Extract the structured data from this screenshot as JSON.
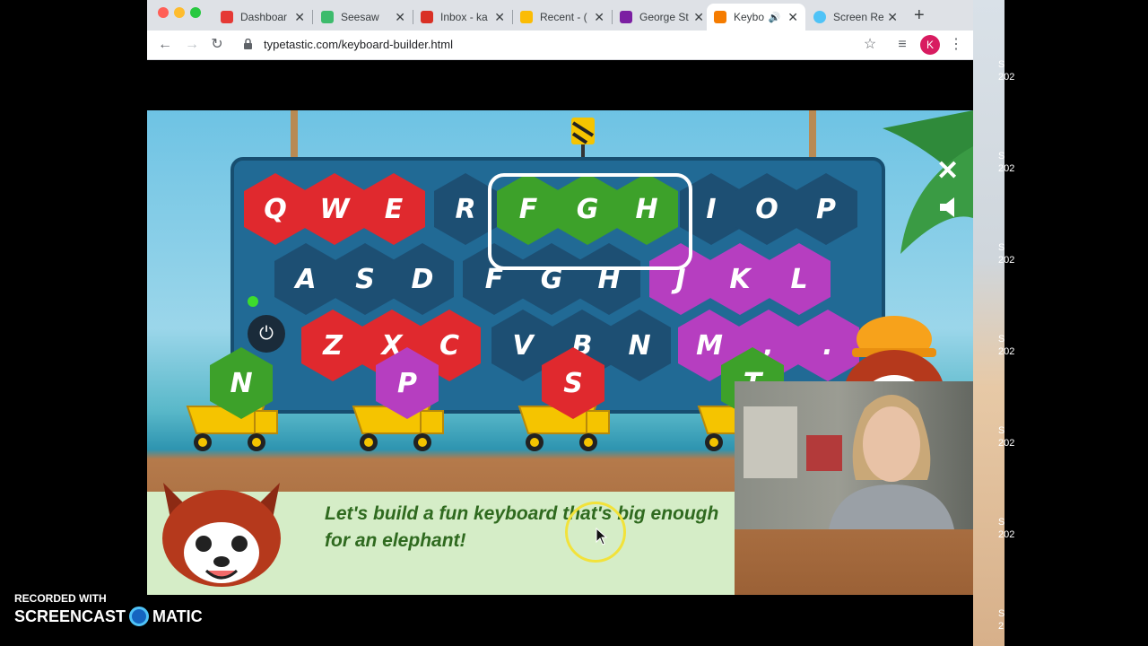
{
  "browser": {
    "tabs": [
      {
        "title": "Dashboar",
        "favicon_color": "#e53935"
      },
      {
        "title": "Seesaw",
        "favicon_color": "#3dbb6c"
      },
      {
        "title": "Inbox - ka",
        "favicon_color": "#d93025"
      },
      {
        "title": "Recent - (",
        "favicon_color": "#fbbc04"
      },
      {
        "title": "George St",
        "favicon_color": "#7b1fa2"
      },
      {
        "title": "Keybo",
        "favicon_color": "#f57c00",
        "active": true
      },
      {
        "title": "Screen Re",
        "favicon_color": "#4fc3f7"
      }
    ],
    "close_glyph": "✕",
    "new_tab_glyph": "+",
    "url": "typetastic.com/keyboard-builder.html",
    "profile_initial": "K",
    "icons": [
      "back-icon",
      "forward-icon",
      "reload-icon",
      "lock-icon",
      "star-icon",
      "media-icon",
      "menu-icon"
    ]
  },
  "keyboard": {
    "rows": [
      [
        "Q",
        "W",
        "E",
        "R",
        "F",
        "G",
        "H",
        "I",
        "O",
        "P"
      ],
      [
        "A",
        "S",
        "D",
        "F",
        "G",
        "H",
        "J",
        "K",
        "L"
      ],
      [
        "Z",
        "X",
        "C",
        "V",
        "B",
        "N",
        "M",
        ",",
        "."
      ]
    ],
    "hanging_group": [
      "F",
      "G",
      "H"
    ],
    "close_glyph": "✕"
  },
  "trucks": [
    "N",
    "P",
    "S",
    "T"
  ],
  "dialog": {
    "message": "Let's build a fun keyboard that's big enough for an elephant!"
  },
  "colors": {
    "red": "#e0292e",
    "blue": "#1d4f73",
    "green": "#3da12a",
    "purple": "#b63ec0",
    "dialog_text": "#2f6a1f"
  },
  "side_snaps": [
    "S",
    "202",
    "S",
    "202",
    "S",
    "202",
    "S",
    "202",
    "S",
    "202",
    "S",
    "202",
    "S",
    "2",
    "S",
    "2"
  ],
  "watermark": {
    "line1": "RECORDED WITH",
    "brand_left": "SCREENCAST",
    "brand_right": "MATIC"
  }
}
